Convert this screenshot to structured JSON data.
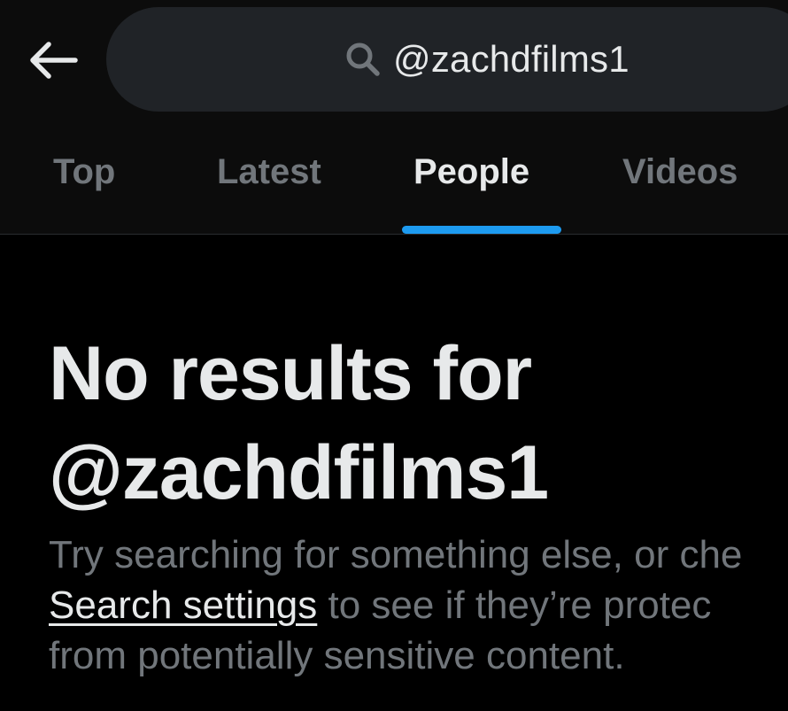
{
  "search": {
    "query": "@zachdfilms1"
  },
  "tabs": [
    {
      "label": "Top",
      "active": false
    },
    {
      "label": "Latest",
      "active": false
    },
    {
      "label": "People",
      "active": true
    },
    {
      "label": "Videos",
      "active": false
    }
  ],
  "empty_state": {
    "title_line1": "No results for",
    "title_line2": "@zachdfilms1",
    "body_line1": "Try searching for something else, or che",
    "link_text": "Search settings",
    "body_line2_rest": " to see if they’re protec",
    "body_line3": "from potentially sensitive content."
  },
  "colors": {
    "background": "#000000",
    "header_background": "#0c0c0c",
    "search_pill": "#202327",
    "primary_text": "#e7e9ea",
    "secondary_text": "#71767b",
    "accent": "#1d9bf0"
  },
  "icons": {
    "back": "arrow-left-icon",
    "search": "search-icon"
  }
}
